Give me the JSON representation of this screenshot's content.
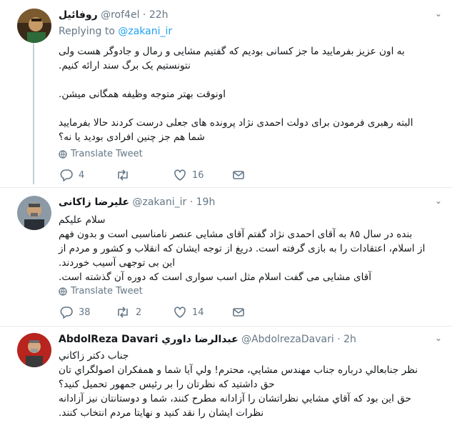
{
  "tweets": [
    {
      "name": "روفائیل",
      "handle": "@rof4el",
      "dot": "·",
      "time": "22h",
      "replying_prefix": "Replying to",
      "replying_to": "@zakani_ir",
      "lines": [
        "به اون عزیز بفرمایید ما جز کسانی بودیم که گفتیم مشایی و رمال و جادوگر هست ولی",
        "نتونستیم یک برگ سند ارائه کنیم.",
        "",
        "اونوقت بهتر متوجه وظیفه همگانی میشن.",
        "",
        "البته رهبری فرمودن برای دولت احمدی نژاد پرونده های جعلی درست کردند حالا بفرمایید",
        "شما هم جز چنین افرادی بودید یا نه؟"
      ],
      "translate": "Translate Tweet",
      "replies": "4",
      "retweets": "",
      "likes": "16"
    },
    {
      "name": "علیرضا زاکانی",
      "handle": "@zakani_ir",
      "dot": "·",
      "time": "19h",
      "lines": [
        "سلام علیکم",
        "بنده در سال ۸۵ به آقای احمدی نژاد گفتم آقای مشایی عنصر نامناسبی است و بدون فهم",
        "از اسلام، اعتقادات را به بازی گرفته است. دریغ از توجه ایشان که انقلاب و کشور و مردم از",
        "این بی توجهی آسیب خوردند.",
        "آقای مشایی می گفت اسلام مثل اسب سواری است که دوره آن گذشته است."
      ],
      "translate": "Translate Tweet",
      "replies": "38",
      "retweets": "2",
      "likes": "14"
    },
    {
      "name": "AbdolReza Davari عبدالرضا داوري",
      "handle": "@AbdolrezaDavari",
      "dot": "·",
      "time": "2h",
      "lines": [
        "جناب دكتر زاكاني",
        "نظر جنابعالي درباره جناب مهندس مشايي، محترم! ولي آيا شما و همفكران اصولگراي تان",
        "حق داشتيد كه نظرتان را بر رئيس جمهور تحميل كنيد؟",
        "حق اين بود كه آقاي مشايي نظراتشان را آزادانه مطرح كنند، شما و دوستانتان نيز آزادانه",
        "نظرات ايشان را نقد كنيد و نهايتا مردم انتخاب كنند."
      ]
    }
  ],
  "icons": {
    "reply": "reply-icon",
    "retweet": "retweet-icon",
    "like": "heart-icon",
    "dm": "envelope-icon",
    "globe": "globe-icon",
    "more": "chevron-down-icon"
  },
  "colors": {
    "text": "#14171a",
    "muted": "#657786",
    "link": "#1da1f2",
    "thread_line": "#c4cfd6",
    "divider": "#e6ecf0"
  }
}
